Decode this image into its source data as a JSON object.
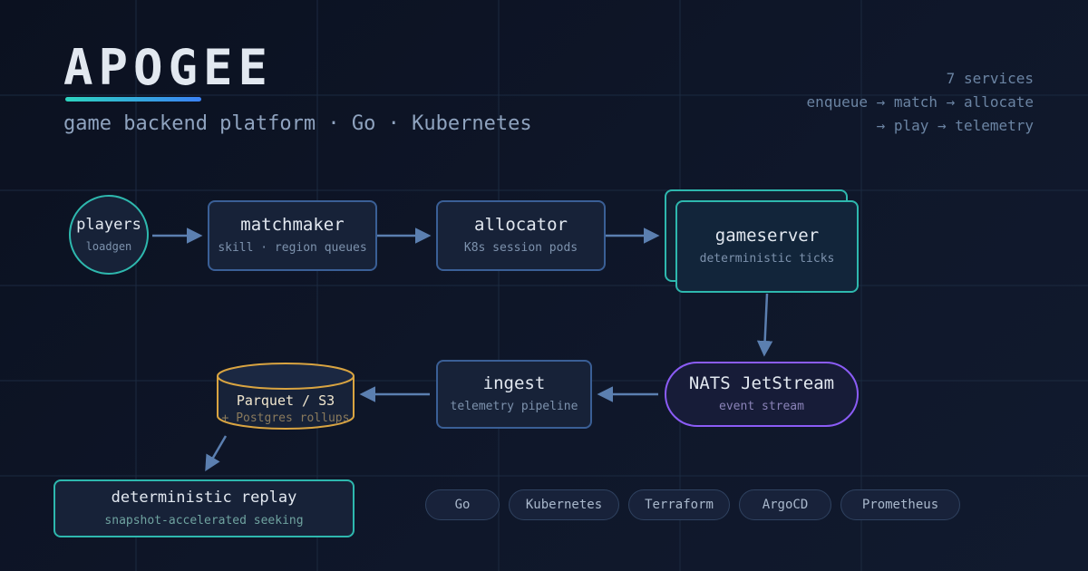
{
  "title": "APOGEE",
  "subtitle": "game backend platform · Go · Kubernetes",
  "stats": {
    "services": "7 services",
    "pipeline_line1": "enqueue → match → allocate",
    "pipeline_line2": "→ play → telemetry"
  },
  "nodes": {
    "players": {
      "title": "players",
      "sub": "loadgen"
    },
    "matchmaker": {
      "title": "matchmaker",
      "sub": "skill · region queues"
    },
    "allocator": {
      "title": "allocator",
      "sub": "K8s session pods"
    },
    "gameserver": {
      "title": "gameserver",
      "sub": "deterministic ticks"
    },
    "nats": {
      "title": "NATS JetStream",
      "sub": "event stream"
    },
    "ingest": {
      "title": "ingest",
      "sub": "telemetry pipeline"
    },
    "storage": {
      "title": "Parquet / S3",
      "sub": "+ Postgres rollups"
    },
    "replay": {
      "title": "deterministic replay",
      "sub": "snapshot-accelerated seeking"
    }
  },
  "tech": [
    "Go",
    "Kubernetes",
    "Terraform",
    "ArgoCD",
    "Prometheus"
  ],
  "colors": {
    "background": "#0f172a",
    "node_border": "#3a5f96",
    "teal": "#2eb8ae",
    "violet": "#8b5cf6",
    "amber": "#d9a441",
    "arrow": "#5b7fb0"
  }
}
